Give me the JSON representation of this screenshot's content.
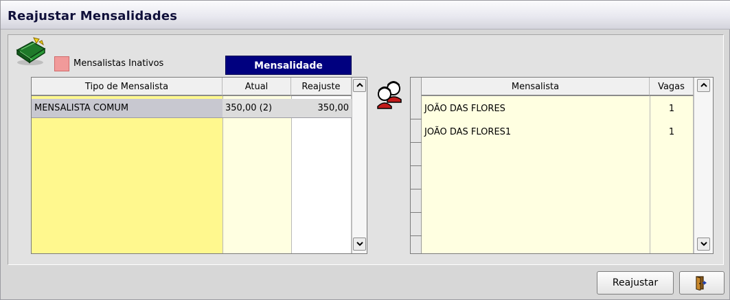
{
  "window": {
    "title": "Reajustar Mensalidades"
  },
  "legend": {
    "label": "Mensalistas Inativos",
    "color": "#f19a9a"
  },
  "tab": {
    "label": "Mensalidade"
  },
  "left_grid": {
    "headers": [
      "Tipo de Mensalista",
      "Atual",
      "Reajuste"
    ],
    "rows": [
      {
        "tipo": "MENSALISTA COMUM",
        "atual": "350,00 (2)",
        "reajuste": "350,00"
      }
    ]
  },
  "right_grid": {
    "headers": [
      "Mensalista",
      "Vagas"
    ],
    "rows": [
      {
        "mensalista": "JOÃO DAS FLORES",
        "vagas": "1"
      },
      {
        "mensalista": "JOÃO DAS FLORES1",
        "vagas": "1"
      }
    ]
  },
  "buttons": {
    "reajustar": "Reajustar",
    "sair_icon": "exit-door-icon"
  },
  "icons": {
    "money": "money-stack-icon",
    "people": "people-icon"
  },
  "colors": {
    "tab_bg": "#00007f",
    "yellow_column": "#fff88e",
    "pale_yellow": "#ffffe1",
    "selected_row": "#c8c8d0"
  }
}
